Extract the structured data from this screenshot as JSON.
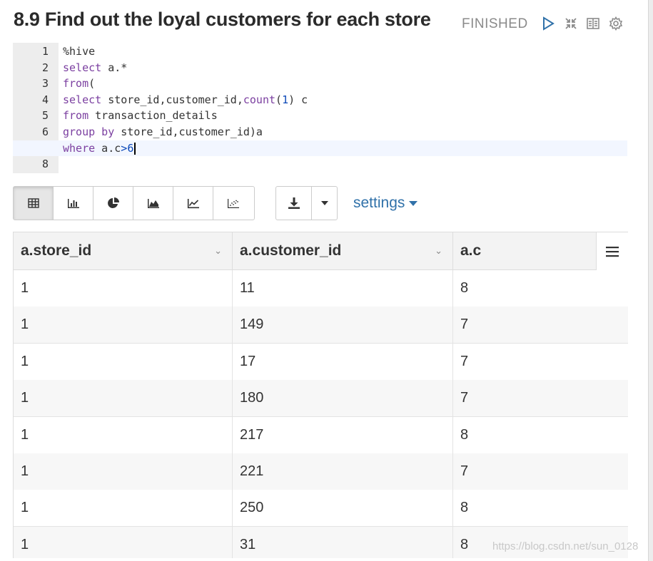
{
  "paragraph": {
    "title": "8.9 Find out the loyal customers for each store",
    "status": "FINISHED"
  },
  "controls": [
    {
      "name": "run-paragraph-button",
      "icon": "play-icon"
    },
    {
      "name": "hide-editor-button",
      "icon": "collapse-icon"
    },
    {
      "name": "toggle-output-button",
      "icon": "book-icon"
    },
    {
      "name": "paragraph-settings-button",
      "icon": "gear-icon"
    }
  ],
  "editor": {
    "lines": [
      {
        "num": "1",
        "tokens": [
          {
            "t": "%hive",
            "c": "tx"
          }
        ]
      },
      {
        "num": "2",
        "tokens": [
          {
            "t": "select",
            "c": "kw"
          },
          {
            "t": " a.*",
            "c": "tx"
          }
        ]
      },
      {
        "num": "3",
        "tokens": [
          {
            "t": "from",
            "c": "kw"
          },
          {
            "t": "(",
            "c": "tx"
          }
        ]
      },
      {
        "num": "4",
        "tokens": [
          {
            "t": "select",
            "c": "kw"
          },
          {
            "t": " store_id,customer_id,",
            "c": "tx"
          },
          {
            "t": "count",
            "c": "fn"
          },
          {
            "t": "(",
            "c": "tx"
          },
          {
            "t": "1",
            "c": "nm"
          },
          {
            "t": ") c",
            "c": "tx"
          }
        ]
      },
      {
        "num": "5",
        "tokens": [
          {
            "t": "from",
            "c": "kw"
          },
          {
            "t": " transaction_details",
            "c": "tx"
          }
        ]
      },
      {
        "num": "6",
        "tokens": [
          {
            "t": "group by",
            "c": "kw"
          },
          {
            "t": " store_id,customer_id)a",
            "c": "tx"
          }
        ]
      },
      {
        "num": "",
        "active": true,
        "tokens": [
          {
            "t": "where",
            "c": "kw"
          },
          {
            "t": " a.c",
            "c": "tx"
          },
          {
            "t": ">",
            "c": "nm"
          },
          {
            "t": "6",
            "c": "nm"
          }
        ]
      },
      {
        "num": "8",
        "tokens": []
      }
    ]
  },
  "toolbar": {
    "viz_buttons": [
      {
        "name": "table-view-button",
        "icon": "table-icon",
        "active": true
      },
      {
        "name": "bar-chart-button",
        "icon": "bar-chart-icon"
      },
      {
        "name": "pie-chart-button",
        "icon": "pie-chart-icon"
      },
      {
        "name": "area-chart-button",
        "icon": "area-chart-icon"
      },
      {
        "name": "line-chart-button",
        "icon": "line-chart-icon"
      },
      {
        "name": "scatter-chart-button",
        "icon": "scatter-chart-icon"
      }
    ],
    "download_icon": "download-icon",
    "settings_label": "settings"
  },
  "table": {
    "columns": [
      "a.store_id",
      "a.customer_id",
      "a.c"
    ],
    "rows": [
      [
        "1",
        "11",
        "8"
      ],
      [
        "1",
        "149",
        "7"
      ],
      [
        "1",
        "17",
        "7"
      ],
      [
        "1",
        "180",
        "7"
      ],
      [
        "1",
        "217",
        "8"
      ],
      [
        "1",
        "221",
        "7"
      ],
      [
        "1",
        "250",
        "8"
      ],
      [
        "1",
        "31",
        "8"
      ]
    ]
  },
  "watermark": "https://blog.csdn.net/sun_0128"
}
